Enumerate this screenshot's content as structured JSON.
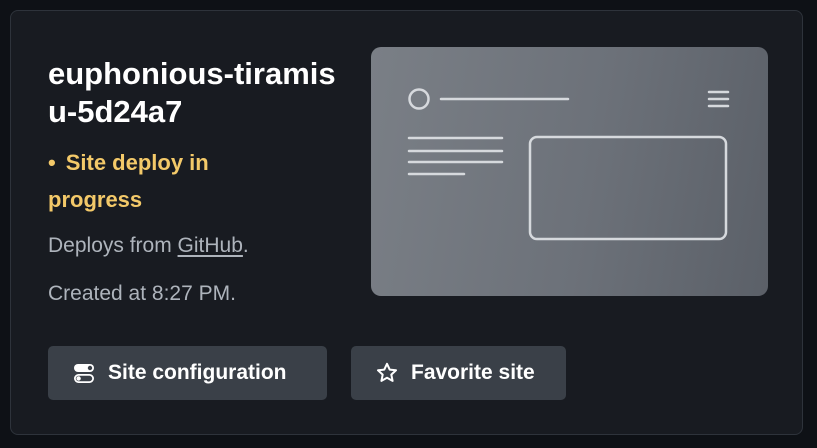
{
  "site": {
    "name": "euphonious-tiramisu-5d24a7",
    "status_dot": "•",
    "status": "Site deploy in progress",
    "deploys_prefix": "Deploys from ",
    "deploys_link": "GitHub",
    "deploys_suffix": ".",
    "created": "Created at 8:27 PM."
  },
  "buttons": {
    "config_label": "Site configuration",
    "config_icon": "toggle-icon",
    "favorite_label": "Favorite site",
    "favorite_icon": "star-icon"
  },
  "colors": {
    "background": "#0e1116",
    "card": "#181b21",
    "status": "#f3c969",
    "muted_text": "#aeb4bc",
    "button": "#3a4048"
  }
}
